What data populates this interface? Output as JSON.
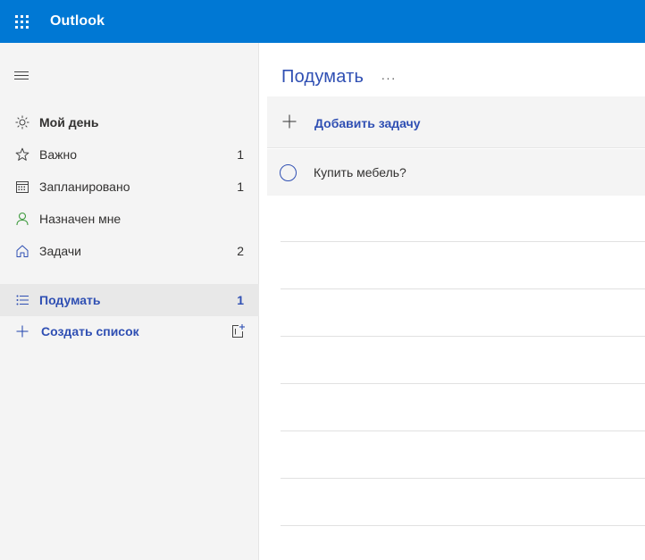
{
  "app": {
    "title": "Outlook"
  },
  "sidebar": {
    "items": [
      {
        "label": "Мой день",
        "count": "",
        "icon": "sun-icon"
      },
      {
        "label": "Важно",
        "count": "1",
        "icon": "star-icon"
      },
      {
        "label": "Запланировано",
        "count": "1",
        "icon": "calendar-icon"
      },
      {
        "label": "Назначен мне",
        "count": "",
        "icon": "person-icon"
      },
      {
        "label": "Задачи",
        "count": "2",
        "icon": "home-icon"
      }
    ],
    "lists": [
      {
        "label": "Подумать",
        "count": "1",
        "icon": "list-icon"
      }
    ],
    "create_list": {
      "label": "Создать список"
    }
  },
  "main": {
    "title": "Подумать",
    "more_label": "···",
    "add_task": {
      "label": "Добавить задачу"
    },
    "tasks": [
      {
        "title": "Купить мебель?"
      }
    ]
  },
  "colors": {
    "topbar": "#0078d4",
    "accent": "#2f4fb3",
    "sidebar_bg": "#f4f4f4"
  }
}
